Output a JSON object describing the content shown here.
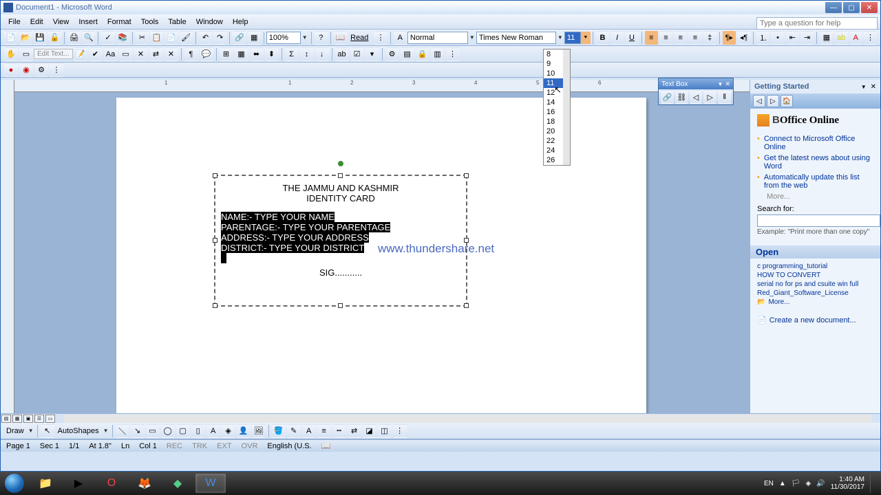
{
  "title": "Document1 - Microsoft Word",
  "menus": [
    "File",
    "Edit",
    "View",
    "Insert",
    "Format",
    "Tools",
    "Table",
    "Window",
    "Help"
  ],
  "question_placeholder": "Type a question for help",
  "zoom": "100%",
  "read_label": "Read",
  "style": "Normal",
  "font": "Times New Roman",
  "font_size": "11",
  "font_sizes": [
    "8",
    "9",
    "10",
    "11",
    "12",
    "14",
    "16",
    "18",
    "20",
    "22",
    "24",
    "26"
  ],
  "edit_text_label": "Edit Text...",
  "draw_label": "Draw",
  "autoshapes_label": "AutoShapes",
  "textbox_toolbar_title": "Text Box",
  "taskpane": {
    "title": "Getting Started",
    "office_brand": "Office Online",
    "links": [
      "Connect to Microsoft Office Online",
      "Get the latest news about using Word",
      "Automatically update this list from the web"
    ],
    "more": "More...",
    "search_label": "Search for:",
    "example": "Example: \"Print more than one copy\"",
    "open_header": "Open",
    "recent": [
      "c programming_tutorial",
      "HOW TO CONVERT",
      "serial no for ps and csuite win full",
      "Red_Giant_Software_License"
    ],
    "more2": "More...",
    "create": "Create a new document..."
  },
  "document": {
    "title1": "THE JAMMU AND KASHMIR",
    "title2": "IDENTITY CARD",
    "line1": "NAME:- TYPE YOUR NAME",
    "line2": "PARENTAGE:- TYPE YOUR PARENTAGE",
    "line3": "ADDRESS:- TYPE YOUR ADDRESS",
    "line4": "DISTRICT:- TYPE YOUR DISTRICT",
    "sig": "SIG..........."
  },
  "watermark": "www.thundershare.net",
  "status": {
    "page": "Page 1",
    "sec": "Sec 1",
    "pages": "1/1",
    "at": "At 1.8\"",
    "ln": "Ln",
    "col": "Col 1",
    "rec": "REC",
    "trk": "TRK",
    "ext": "EXT",
    "ovr": "OVR",
    "lang": "English (U.S."
  },
  "tray": {
    "lang": "EN",
    "time": "1:40 AM",
    "date": "11/30/2017"
  }
}
